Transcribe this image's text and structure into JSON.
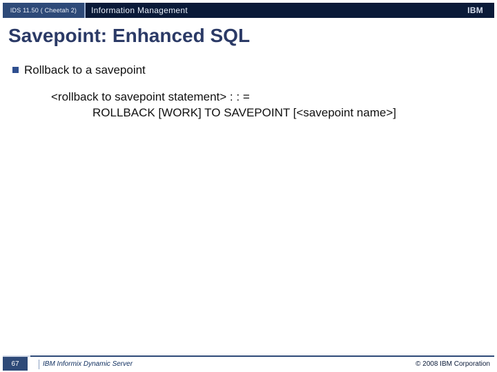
{
  "header": {
    "left_label": "IDS 11.50 ( Cheetah 2)",
    "right_label": "Information Management",
    "logo_text": "IBM"
  },
  "title": "Savepoint: Enhanced SQL",
  "content": {
    "bullet1": "Rollback to a savepoint",
    "syntax_line1": "<rollback to savepoint statement> : : =",
    "syntax_line2": "ROLLBACK [WORK] TO SAVEPOINT [<savepoint name>]"
  },
  "footer": {
    "page_number": "67",
    "product": "IBM Informix Dynamic Server",
    "copyright": "© 2008 IBM Corporation"
  }
}
